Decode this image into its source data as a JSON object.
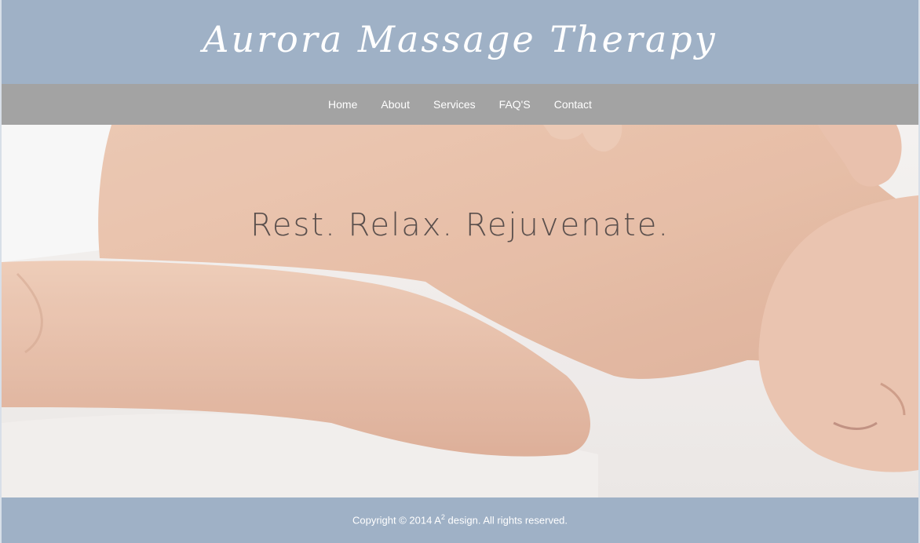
{
  "header": {
    "site_title": "Aurora Massage Therapy"
  },
  "nav": {
    "items": [
      {
        "label": "Home"
      },
      {
        "label": "About"
      },
      {
        "label": "Services"
      },
      {
        "label": "FAQ'S"
      },
      {
        "label": "Contact"
      }
    ]
  },
  "hero": {
    "tagline": "Rest. Relax. Rejuvenate."
  },
  "footer": {
    "copyright_prefix": "Copyright © 2014 A",
    "copyright_sup": "2",
    "copyright_suffix": " design. All rights reserved."
  },
  "colors": {
    "header_bg": "#9fb1c6",
    "nav_bg": "#a3a3a3",
    "footer_bg": "#9fb1c6",
    "text_light": "#ffffff",
    "tagline": "#5a4f4c"
  }
}
